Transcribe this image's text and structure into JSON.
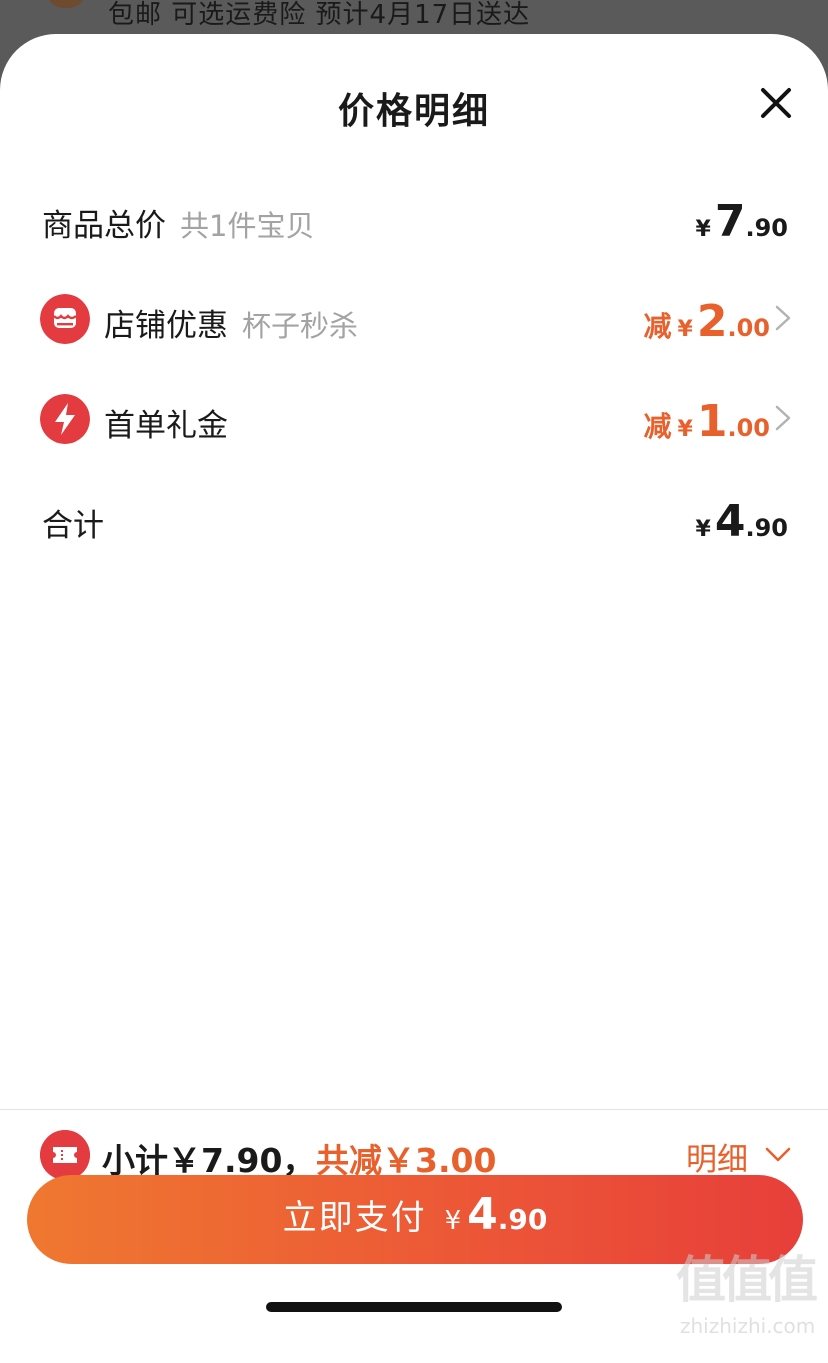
{
  "background_bar": {
    "text": "包邮  可选运费险  预计4月17日送达"
  },
  "sheet": {
    "title": "价格明细",
    "close_icon": "close-icon"
  },
  "rows": [
    {
      "label": "商品总价",
      "sub": "共1件宝贝",
      "price_prefix": "",
      "yen": "¥",
      "int": "7",
      "dec": ".90",
      "color": "#1a1a1a"
    },
    {
      "label": "店铺优惠",
      "sub": "杯子秒杀",
      "icon": "shop-icon",
      "price_prefix": "减",
      "yen": "¥",
      "int": "2",
      "dec": ".00",
      "color": "#e8612c"
    },
    {
      "label": "首单礼金",
      "sub": "",
      "icon": "lightning-icon",
      "price_prefix": "减",
      "yen": "¥",
      "int": "1",
      "dec": ".00",
      "color": "#e8612c"
    },
    {
      "label": "合计",
      "sub": "",
      "price_prefix": "",
      "yen": "¥",
      "int": "4",
      "dec": ".90",
      "color": "#1a1a1a"
    }
  ],
  "summary": {
    "subtotal": "小计￥7.90，",
    "total_reduce": "共减￥3.00",
    "detail": "明细",
    "icon": "ticket-icon"
  },
  "pay_button": {
    "label": "立即支付",
    "yen": "¥",
    "int": "4",
    "dec": ".90"
  },
  "watermark": {
    "big": "值值值",
    "small": "zhizhizhi.com"
  },
  "colors": {
    "accent": "#e8612c",
    "icon_red": "#e33b3f",
    "button_start": "#ef7830",
    "button_end": "#e73f3a"
  }
}
